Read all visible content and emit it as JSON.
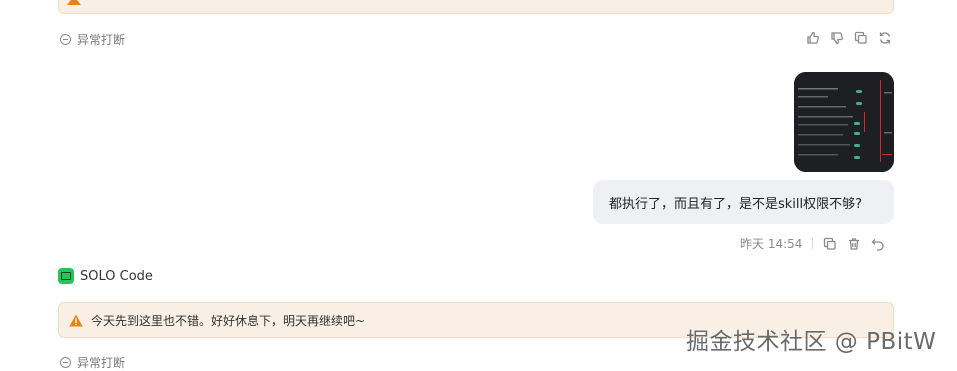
{
  "top_warning": {
    "fragment": "…今天先到这里也不错。好好休息下，明天再继续吧~"
  },
  "interrupt_label": "异常打断",
  "user_message": {
    "text": "都执行了，而且有了，是不是skill权限不够?",
    "timestamp": "昨天 14:54"
  },
  "agent": {
    "name": "SOLO Code"
  },
  "warning": {
    "text": "今天先到这里也不错。好好休息下，明天再继续吧~"
  },
  "watermark": "掘金技术社区 @ PBitW",
  "colors": {
    "warning_bg": "#f9efe4",
    "warning_icon": "#e8840c",
    "agent_logo": "#22c55e",
    "bubble_bg": "#eef0f3"
  }
}
